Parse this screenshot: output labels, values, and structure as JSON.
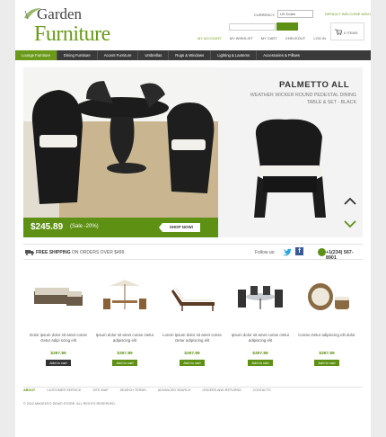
{
  "logo": {
    "line1": "Garden",
    "line2": "Furniture"
  },
  "header": {
    "currency_label": "CURRENCY:",
    "currency_value": "US Dollar",
    "welcome": "DEFAULT WELCOME MSG!",
    "search_button": "",
    "cart_items": "0 ITEMS"
  },
  "top_links": [
    "MY ACCOUNT",
    "MY WISHLIST",
    "MY CART",
    "CHECKOUT",
    "LOG IN"
  ],
  "nav": [
    "Lounge Furniture",
    "Dining Furniture",
    "Accent Furniture",
    "Umbrellas",
    "Rugs & Windows",
    "Lighting & Lanterns",
    "Accessories & Pillows"
  ],
  "hero": {
    "title": "PALMETTO ALL",
    "subtitle": "WEATHER WICKER ROUND PEDESTAL DINING TABLE & SET - BLACK",
    "price": "$245.89",
    "sale": "(Sale -20%)",
    "shop_button": "SHOP NOW!"
  },
  "info_bar": {
    "shipping_bold": "FREE SHIPPING",
    "shipping_rest": "ON ORDERS OVER $499",
    "follow": "Follow us:",
    "phone": "+1(234) 567-8901"
  },
  "products": [
    {
      "desc": "Dolor ipsum dolor sit amet conse ctetur adipi scing elit",
      "price": "$397.89",
      "button": "Add to cart"
    },
    {
      "desc": "Ipsum dolor sit amet conse ctetur adipiscing elit",
      "price": "$397.89",
      "button": "Add to cart"
    },
    {
      "desc": "Lorem ipsum dolor sit amet conse ctetur adipiscing elit",
      "price": "$397.89",
      "button": "Add to cart"
    },
    {
      "desc": "Ipsum dolor sit amet conse ctetur adipiscing elit",
      "price": "$397.89",
      "button": "Add to cart"
    },
    {
      "desc": "Conse ctetur adipiscing elit dolor",
      "price": "$397.89",
      "button": "Add to cart"
    }
  ],
  "footer": {
    "links": [
      "ABOUT",
      "CUSTOMER SERVICE",
      "SITE MAP",
      "SEARCH TERMS",
      "ADVANCED SEARCH",
      "ORDERS AND RETURNS",
      "CONTACTS"
    ],
    "copyright": "© 2012 MAGENTO DEMO STORE. ALL RIGHTS RESERVED."
  },
  "colors": {
    "accent": "#5e9014",
    "nav_bg": "#3a3a3a"
  }
}
